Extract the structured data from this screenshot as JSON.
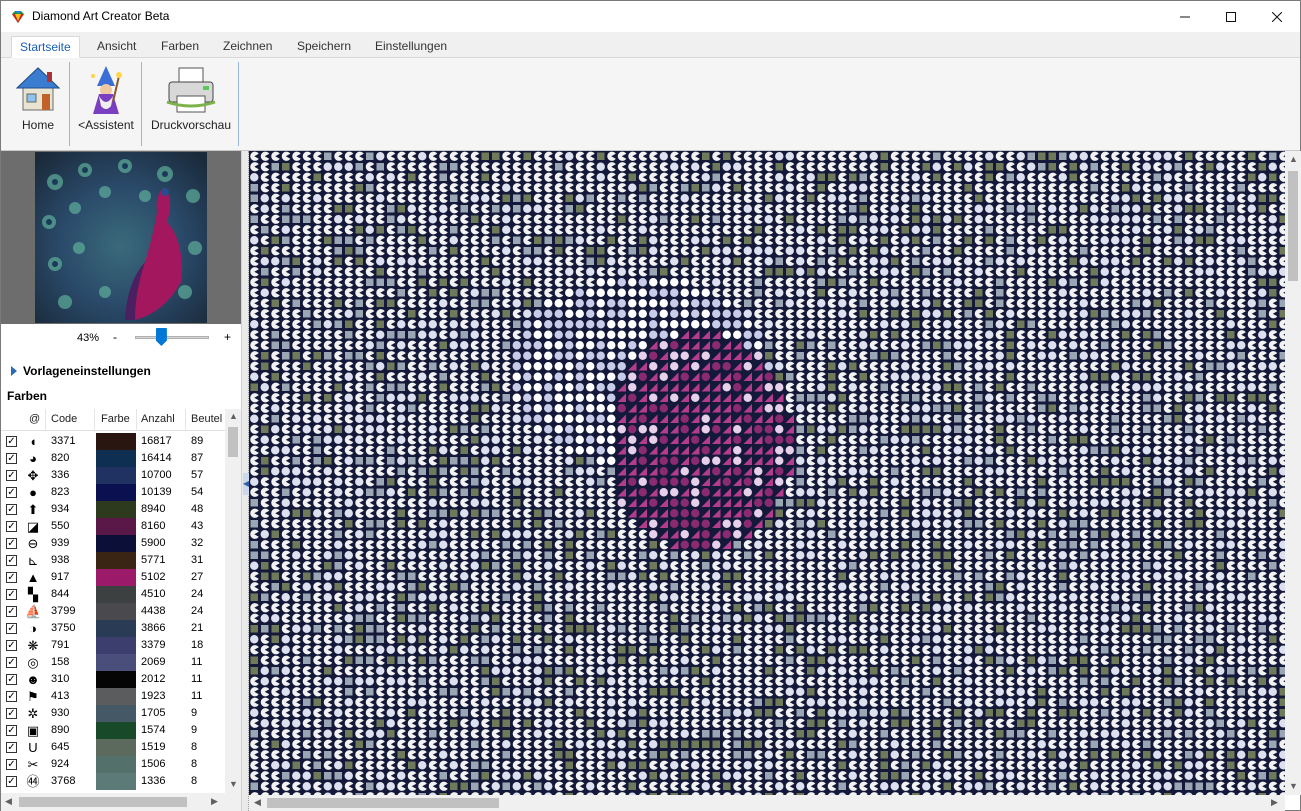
{
  "window": {
    "title": "Diamond Art Creator Beta"
  },
  "tabs": [
    "Startseite",
    "Ansicht",
    "Farben",
    "Zeichnen",
    "Speichern",
    "Einstellungen"
  ],
  "ribbon": {
    "home": "Home",
    "assistant": "<Assistent",
    "print_preview": "Druckvorschau"
  },
  "zoom": {
    "percent": "43%",
    "minus": "-",
    "plus": "+",
    "level": 0.35
  },
  "settings_toggle": "Vorlageneinstellungen",
  "colors_section": "Farben",
  "table": {
    "headers": {
      "sym": "@",
      "code": "Code",
      "color": "Farbe",
      "count": "Anzahl",
      "bags": "Beutel"
    },
    "rows": [
      {
        "sym": "◖",
        "code": "3371",
        "hex": "#2a1610",
        "count": "16817",
        "bags": "89"
      },
      {
        "sym": "◕",
        "code": "820",
        "hex": "#0f2f52",
        "count": "16414",
        "bags": "87"
      },
      {
        "sym": "✥",
        "code": "336",
        "hex": "#1f3262",
        "count": "10700",
        "bags": "57"
      },
      {
        "sym": "●",
        "code": "823",
        "hex": "#0a1050",
        "count": "10139",
        "bags": "54"
      },
      {
        "sym": "⬆",
        "code": "934",
        "hex": "#2e3a1e",
        "count": "8940",
        "bags": "48"
      },
      {
        "sym": "◪",
        "code": "550",
        "hex": "#5a1848",
        "count": "8160",
        "bags": "43"
      },
      {
        "sym": "⊖",
        "code": "939",
        "hex": "#0c0f38",
        "count": "5900",
        "bags": "32"
      },
      {
        "sym": "⊾",
        "code": "938",
        "hex": "#3a2414",
        "count": "5771",
        "bags": "31"
      },
      {
        "sym": "▲",
        "code": "917",
        "hex": "#9b1a6a",
        "count": "5102",
        "bags": "27"
      },
      {
        "sym": "▚",
        "code": "844",
        "hex": "#3c4040",
        "count": "4510",
        "bags": "24"
      },
      {
        "sym": "⛵",
        "code": "3799",
        "hex": "#4a4a4e",
        "count": "4438",
        "bags": "24"
      },
      {
        "sym": "◑",
        "code": "3750",
        "hex": "#2a3c55",
        "count": "3866",
        "bags": "21"
      },
      {
        "sym": "❋",
        "code": "791",
        "hex": "#3c3e6e",
        "count": "3379",
        "bags": "18"
      },
      {
        "sym": "◎",
        "code": "158",
        "hex": "#4a4e7a",
        "count": "2069",
        "bags": "11"
      },
      {
        "sym": "☻",
        "code": "310",
        "hex": "#050505",
        "count": "2012",
        "bags": "11"
      },
      {
        "sym": "⚑",
        "code": "413",
        "hex": "#5a5c5e",
        "count": "1923",
        "bags": "11"
      },
      {
        "sym": "✲",
        "code": "930",
        "hex": "#455866",
        "count": "1705",
        "bags": "9"
      },
      {
        "sym": "▣",
        "code": "890",
        "hex": "#184a2a",
        "count": "1574",
        "bags": "9"
      },
      {
        "sym": "U",
        "code": "645",
        "hex": "#5c6a5e",
        "count": "1519",
        "bags": "8"
      },
      {
        "sym": "✂",
        "code": "924",
        "hex": "#53706a",
        "count": "1506",
        "bags": "8"
      },
      {
        "sym": "㊹",
        "code": "3768",
        "hex": "#5c7a78",
        "count": "1336",
        "bags": "8"
      }
    ]
  }
}
